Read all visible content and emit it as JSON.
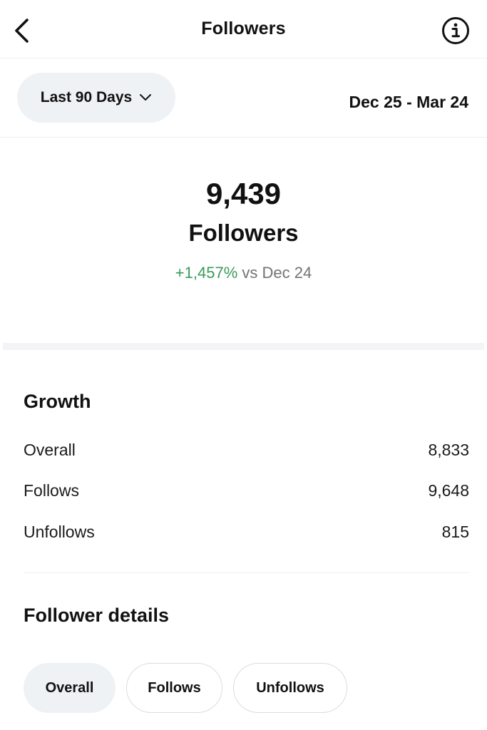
{
  "header": {
    "title": "Followers"
  },
  "range": {
    "selected": "Last 90 Days",
    "dates": "Dec 25 - Mar 24"
  },
  "summary": {
    "count": "9,439",
    "label": "Followers",
    "change": "+1,457%",
    "comparison": " vs Dec 24"
  },
  "growth": {
    "title": "Growth",
    "rows": [
      {
        "label": "Overall",
        "value": "8,833"
      },
      {
        "label": "Follows",
        "value": "9,648"
      },
      {
        "label": "Unfollows",
        "value": "815"
      }
    ]
  },
  "details": {
    "title": "Follower details",
    "chips": [
      {
        "label": "Overall",
        "active": true
      },
      {
        "label": "Follows",
        "active": false
      },
      {
        "label": "Unfollows",
        "active": false
      }
    ]
  },
  "colors": {
    "positive": "#3a9a5a",
    "pill_bg": "#eff2f5",
    "muted": "#737373"
  }
}
